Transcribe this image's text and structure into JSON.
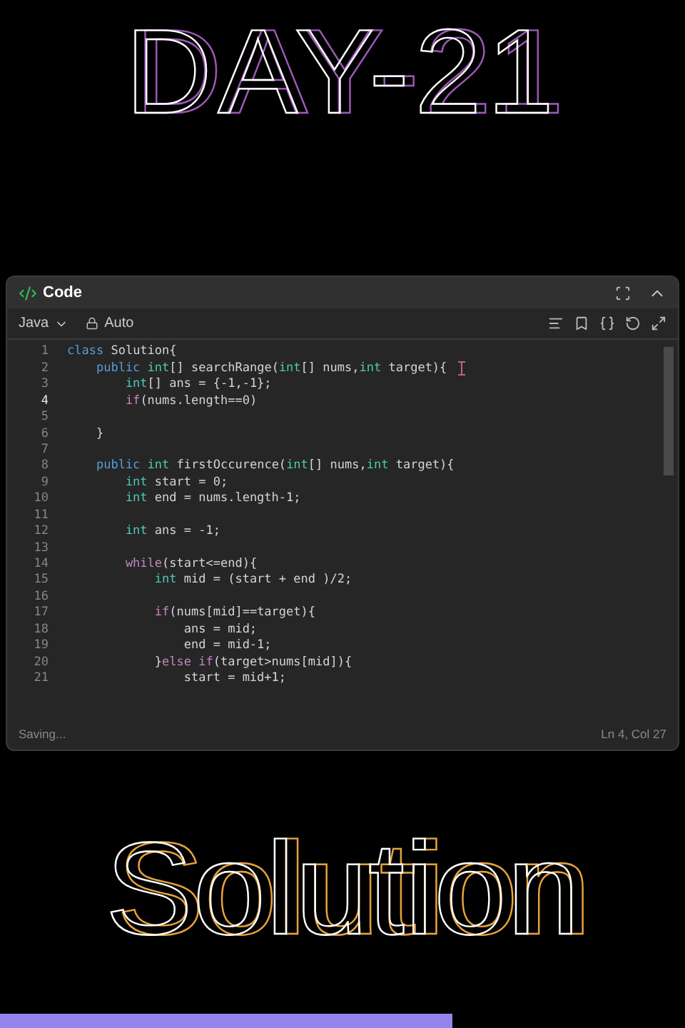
{
  "headline": "DAY-21",
  "editor": {
    "title": "Code",
    "language": "Java",
    "mode": "Auto",
    "lines": [
      {
        "n": "1",
        "current": false,
        "segments": [
          {
            "kind": "kw",
            "text": "class"
          },
          {
            "kind": "plain",
            "text": " Solution{"
          }
        ]
      },
      {
        "n": "2",
        "current": false,
        "segments": [
          {
            "kind": "kw",
            "text": "    public"
          },
          {
            "kind": "type",
            "text": " int"
          },
          {
            "kind": "plain",
            "text": "[] searchRange("
          },
          {
            "kind": "type",
            "text": "int"
          },
          {
            "kind": "plain",
            "text": "[] nums,"
          },
          {
            "kind": "type",
            "text": "int"
          },
          {
            "kind": "plain",
            "text": " target){"
          }
        ]
      },
      {
        "n": "3",
        "current": false,
        "segments": [
          {
            "kind": "type",
            "text": "        int"
          },
          {
            "kind": "plain",
            "text": "[] ans = {-1,-1};"
          }
        ]
      },
      {
        "n": "4",
        "current": true,
        "segments": [
          {
            "kind": "ctl",
            "text": "        if"
          },
          {
            "kind": "plain",
            "text": "(nums.length==0)"
          }
        ]
      },
      {
        "n": "5",
        "current": false
      },
      {
        "n": "6",
        "current": false,
        "segments": [
          {
            "kind": "plain",
            "text": "    }"
          }
        ]
      },
      {
        "n": "7",
        "current": false
      },
      {
        "n": "8",
        "current": false,
        "segments": [
          {
            "kind": "kw",
            "text": "    public"
          },
          {
            "kind": "type",
            "text": " int"
          },
          {
            "kind": "plain",
            "text": " firstOccurence("
          },
          {
            "kind": "type",
            "text": "int"
          },
          {
            "kind": "plain",
            "text": "[] nums,"
          },
          {
            "kind": "type",
            "text": "int"
          },
          {
            "kind": "plain",
            "text": " target){"
          }
        ]
      },
      {
        "n": "9",
        "current": false,
        "segments": [
          {
            "kind": "type",
            "text": "        int"
          },
          {
            "kind": "plain",
            "text": " start = 0;"
          }
        ]
      },
      {
        "n": "10",
        "current": false,
        "segments": [
          {
            "kind": "type",
            "text": "        int"
          },
          {
            "kind": "plain",
            "text": " end = nums.length-1;"
          }
        ]
      },
      {
        "n": "11",
        "current": false
      },
      {
        "n": "12",
        "current": false,
        "segments": [
          {
            "kind": "type",
            "text": "        int"
          },
          {
            "kind": "plain",
            "text": " ans = -1;"
          }
        ]
      },
      {
        "n": "13",
        "current": false
      },
      {
        "n": "14",
        "current": false,
        "segments": [
          {
            "kind": "ctl",
            "text": "        while"
          },
          {
            "kind": "plain",
            "text": "(start<=end){"
          }
        ]
      },
      {
        "n": "15",
        "current": false,
        "segments": [
          {
            "kind": "type",
            "text": "            int"
          },
          {
            "kind": "plain",
            "text": " mid = (start + end )/2;"
          }
        ]
      },
      {
        "n": "16",
        "current": false
      },
      {
        "n": "17",
        "current": false,
        "segments": [
          {
            "kind": "ctl",
            "text": "            if"
          },
          {
            "kind": "plain",
            "text": "(nums[mid]==target){"
          }
        ]
      },
      {
        "n": "18",
        "current": false,
        "segments": [
          {
            "kind": "plain",
            "text": "                ans = mid;"
          }
        ]
      },
      {
        "n": "19",
        "current": false,
        "segments": [
          {
            "kind": "plain",
            "text": "                end = mid-1;"
          }
        ]
      },
      {
        "n": "20",
        "current": false,
        "segments": [
          {
            "kind": "plain",
            "text": "            }"
          },
          {
            "kind": "ctl",
            "text": "else if"
          },
          {
            "kind": "plain",
            "text": "(target>nums[mid]){"
          }
        ]
      },
      {
        "n": "21",
        "current": false,
        "segments": [
          {
            "kind": "plain",
            "text": "                start = mid+1;"
          }
        ]
      }
    ],
    "status": "Saving...",
    "position": "Ln 4, Col 27"
  },
  "caption": "Solution",
  "progress": {
    "level": 0.66
  }
}
